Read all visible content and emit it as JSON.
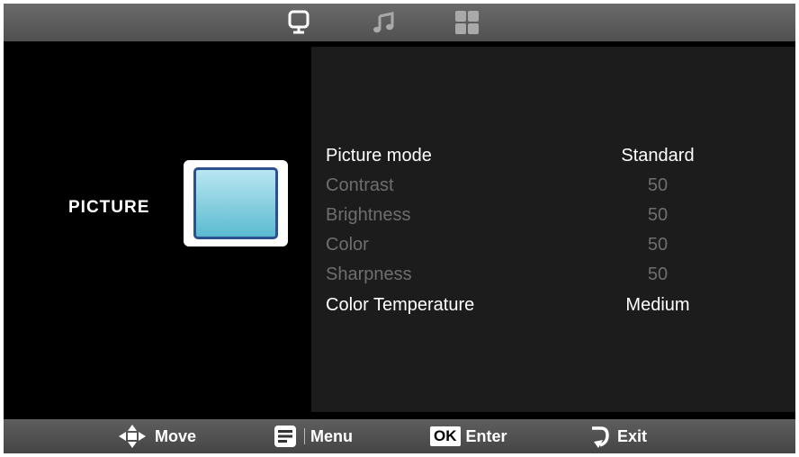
{
  "tabs": [
    {
      "icon": "monitor-icon",
      "active": true
    },
    {
      "icon": "music-note-icon",
      "active": false
    },
    {
      "icon": "grid-icon",
      "active": false
    }
  ],
  "section": {
    "title": "PICTURE",
    "icon": "picture-icon"
  },
  "menu": {
    "items": [
      {
        "label": "Picture mode",
        "value": "Standard",
        "enabled": true
      },
      {
        "label": "Contrast",
        "value": "50",
        "enabled": false
      },
      {
        "label": "Brightness",
        "value": "50",
        "enabled": false
      },
      {
        "label": "Color",
        "value": "50",
        "enabled": false
      },
      {
        "label": "Sharpness",
        "value": "50",
        "enabled": false
      },
      {
        "label": "Color Temperature",
        "value": "Medium",
        "enabled": true
      }
    ]
  },
  "footer": {
    "move": {
      "label": "Move",
      "icon": "dpad-icon"
    },
    "menu": {
      "label": "Menu",
      "icon": "menu-icon"
    },
    "enter": {
      "badge": "OK",
      "label": "Enter"
    },
    "exit": {
      "label": "Exit",
      "icon": "return-icon"
    }
  },
  "colors": {
    "active_text": "#ffffff",
    "dim_text": "#6e6e6e",
    "panel": "#1c1c1c"
  }
}
